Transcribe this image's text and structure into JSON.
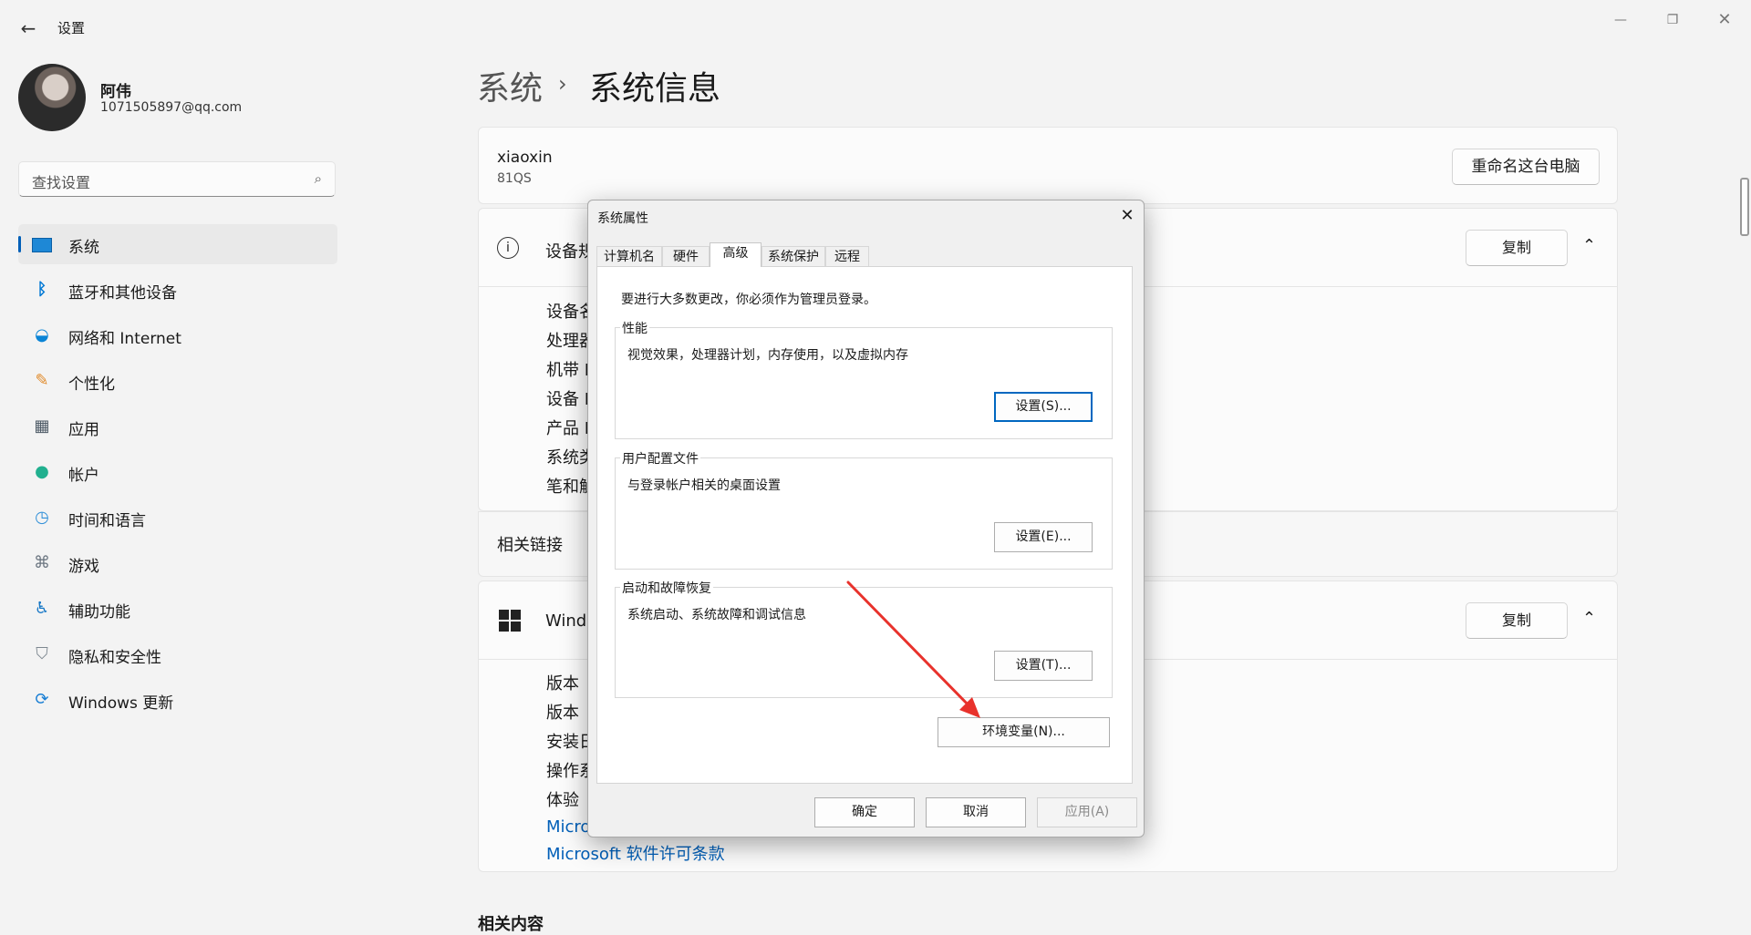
{
  "window": {
    "title": "设置",
    "minimize_icon": "minimize-icon",
    "restore_icon": "restore-icon",
    "close_icon": "close-icon"
  },
  "profile": {
    "name": "阿伟",
    "email": "1071505897@qq.com"
  },
  "search": {
    "placeholder": "查找设置"
  },
  "nav": [
    {
      "label": "系统",
      "icon": "monitor-icon",
      "active": true
    },
    {
      "label": "蓝牙和其他设备",
      "icon": "bluetooth-icon"
    },
    {
      "label": "网络和 Internet",
      "icon": "wifi-icon"
    },
    {
      "label": "个性化",
      "icon": "brush-icon"
    },
    {
      "label": "应用",
      "icon": "apps-icon"
    },
    {
      "label": "帐户",
      "icon": "account-icon"
    },
    {
      "label": "时间和语言",
      "icon": "clock-globe-icon"
    },
    {
      "label": "游戏",
      "icon": "gamepad-icon"
    },
    {
      "label": "辅助功能",
      "icon": "accessibility-icon"
    },
    {
      "label": "隐私和安全性",
      "icon": "shield-icon"
    },
    {
      "label": "Windows 更新",
      "icon": "update-icon"
    }
  ],
  "breadcrumb": {
    "parent": "系统",
    "current": "系统信息"
  },
  "pc": {
    "name": "xiaoxin",
    "model": "81QS",
    "rename_label": "重命名这台电脑"
  },
  "device_spec": {
    "title": "设备规",
    "copy_label": "复制",
    "rows": [
      "设备名",
      "处理器",
      "机带 R",
      "设备 I",
      "产品 I",
      "系统类",
      "笔和触"
    ]
  },
  "related_links": {
    "label": "相关链接"
  },
  "windows_spec": {
    "title": "Windo",
    "copy_label": "复制",
    "rows": [
      "版本",
      "版本",
      "安装日",
      "操作系",
      "体验"
    ],
    "links": [
      "Micros",
      "Microsoft 软件许可条款"
    ]
  },
  "related_content": {
    "label": "相关内容"
  },
  "dialog": {
    "title": "系统属性",
    "tabs": [
      "计算机名",
      "硬件",
      "高级",
      "系统保护",
      "远程"
    ],
    "selected_tab": "高级",
    "admin_note": "要进行大多数更改，你必须作为管理员登录。",
    "performance": {
      "title": "性能",
      "desc": "视觉效果，处理器计划，内存使用，以及虚拟内存",
      "button": "设置(S)..."
    },
    "user_profile": {
      "title": "用户配置文件",
      "desc": "与登录帐户相关的桌面设置",
      "button": "设置(E)..."
    },
    "startup": {
      "title": "启动和故障恢复",
      "desc": "系统启动、系统故障和调试信息",
      "button": "设置(T)..."
    },
    "env_button": "环境变量(N)...",
    "ok": "确定",
    "cancel": "取消",
    "apply": "应用(A)"
  },
  "annotation": {
    "arrow_color": "#e8322c"
  }
}
